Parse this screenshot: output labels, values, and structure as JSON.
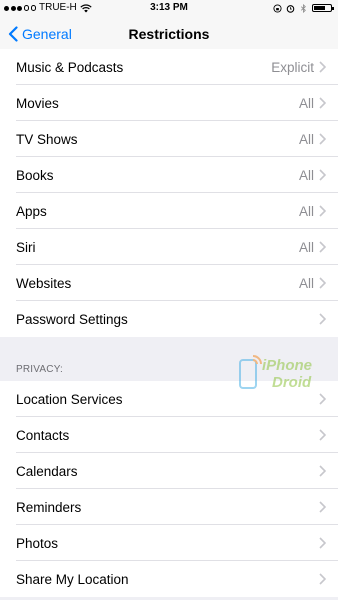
{
  "status_bar": {
    "carrier": "TRUE-H",
    "time": "3:13 PM"
  },
  "nav": {
    "back_label": "General",
    "title": "Restrictions"
  },
  "content_rows": [
    {
      "label": "Music & Podcasts",
      "value": "Explicit"
    },
    {
      "label": "Movies",
      "value": "All"
    },
    {
      "label": "TV Shows",
      "value": "All"
    },
    {
      "label": "Books",
      "value": "All"
    },
    {
      "label": "Apps",
      "value": "All"
    },
    {
      "label": "Siri",
      "value": "All"
    },
    {
      "label": "Websites",
      "value": "All"
    },
    {
      "label": "Password Settings",
      "value": ""
    }
  ],
  "privacy": {
    "header": "PRIVACY:",
    "rows": [
      {
        "label": "Location Services"
      },
      {
        "label": "Contacts"
      },
      {
        "label": "Calendars"
      },
      {
        "label": "Reminders"
      },
      {
        "label": "Photos"
      },
      {
        "label": "Share My Location"
      }
    ]
  },
  "watermark": {
    "line1": "iPhone",
    "line2": "Droid"
  },
  "colors": {
    "accent": "#007aff",
    "watermark": "#8fc43f"
  }
}
